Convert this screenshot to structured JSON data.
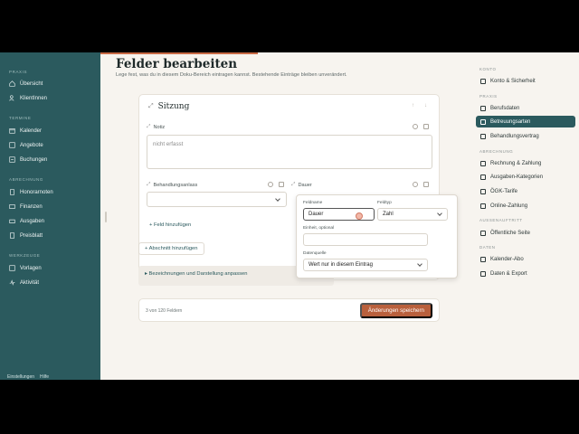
{
  "sidebar": {
    "sections": {
      "praxis": "PRAXIS",
      "termine": "TERMINE",
      "abrechnung": "ABRECHNUNG",
      "werkzeuge": "WERKZEUGE"
    },
    "items": [
      {
        "label": "Übersicht",
        "icon": "home-icon"
      },
      {
        "label": "KlientInnen",
        "icon": "users-icon"
      },
      {
        "label": "Kalender",
        "icon": "calendar-icon"
      },
      {
        "label": "Angebote",
        "icon": "list-icon"
      },
      {
        "label": "Buchungen",
        "icon": "bookings-icon"
      },
      {
        "label": "Honorarnoten",
        "icon": "invoice-icon"
      },
      {
        "label": "Finanzen",
        "icon": "finance-icon"
      },
      {
        "label": "Ausgaben",
        "icon": "expenses-icon"
      },
      {
        "label": "Preisblatt",
        "icon": "pricesheet-icon"
      },
      {
        "label": "Vorlagen",
        "icon": "templates-icon"
      },
      {
        "label": "Aktivität",
        "icon": "activity-icon"
      }
    ],
    "bottom": {
      "settings": "Einstellungen",
      "help": "Hilfe"
    }
  },
  "main": {
    "title": "Felder bearbeiten",
    "subtitle": "Lege fest, was du in diesem Doku-Bereich eintragen kannst. Bestehende Einträge bleiben unverändert.",
    "card": {
      "title": "Sitzung",
      "fields": [
        {
          "label": "Notiz",
          "placeholder": "nicht erfasst"
        },
        {
          "label": "Behandlungsanlass"
        },
        {
          "label": "Dauer"
        }
      ],
      "add_field": "+ Feld hinzufügen"
    },
    "add_section": "+ Abschnitt hinzufügen",
    "disclosure": "▸ Bezeichnungen und Darstellung anpassen",
    "footer": {
      "count": "3 von 120 Feldern",
      "save": "Änderungen speichern"
    }
  },
  "popover": {
    "name_label": "Feldname",
    "name_value": "Dauer",
    "type_label": "Feldtyp",
    "type_value": "Zahl",
    "unit_label": "Einheit, optional",
    "unit_value": "",
    "source_label": "Datenquelle",
    "source_value": "Wert nur in diesem Eintrag"
  },
  "rnav": {
    "sections": {
      "konto": "KONTO",
      "praxis": "PRAXIS",
      "abrechnung": "ABRECHNUNG",
      "aussenauftritt": "AUSSENAUFTRITT",
      "daten": "DATEN"
    },
    "items": [
      {
        "label": "Konto & Sicherheit"
      },
      {
        "label": "Berufsdaten"
      },
      {
        "label": "Betreuungsarten",
        "active": true
      },
      {
        "label": "Behandlungsvertrag"
      },
      {
        "label": "Rechnung & Zahlung"
      },
      {
        "label": "Ausgaben-Kategorien"
      },
      {
        "label": "ÖGK-Tarife"
      },
      {
        "label": "Online-Zahlung"
      },
      {
        "label": "Öffentliche Seite"
      },
      {
        "label": "Kalender-Abo"
      },
      {
        "label": "Daten & Export"
      }
    ]
  },
  "colors": {
    "sidebar": "#2b5a5e",
    "accent": "#b9603d",
    "background": "#f7f4ef"
  }
}
